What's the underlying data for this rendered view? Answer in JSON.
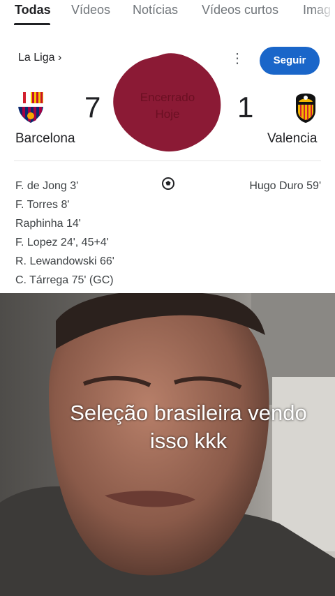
{
  "tabs": [
    "Todas",
    "Vídeos",
    "Notícias",
    "Vídeos curtos",
    "Imag"
  ],
  "match": {
    "league": "La Liga",
    "league_chevron": "›",
    "more_icon": "⋮",
    "follow_label": "Seguir",
    "status": "Encerrado",
    "date": "Hoje",
    "home": {
      "name": "Barcelona",
      "score": "7"
    },
    "away": {
      "name": "Valencia",
      "score": "1"
    },
    "home_scorers": [
      "F. de Jong 3'",
      "F. Torres 8'",
      "Raphinha 14'",
      "F. Lopez 24', 45+4'",
      "R. Lewandowski 66'",
      "C. Tárrega 75' (GC)"
    ],
    "away_scorers": [
      "Hugo Duro 59'"
    ]
  },
  "video": {
    "caption_line1": "Seleção brasileira vendo",
    "caption_line2": "isso kkk"
  },
  "colors": {
    "accent": "#1a66c9",
    "overlay_blob": "#8b1a35"
  }
}
